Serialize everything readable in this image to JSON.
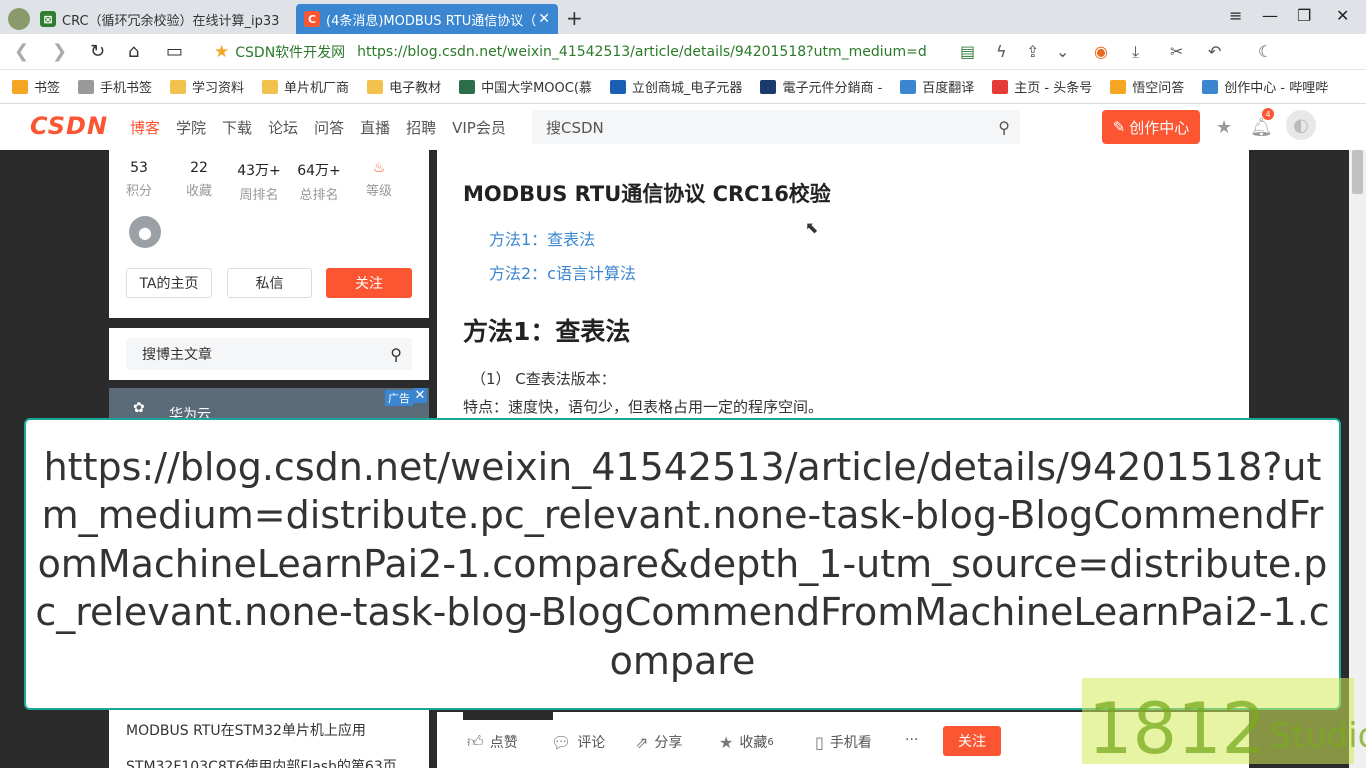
{
  "browser": {
    "tabs": [
      {
        "label": "CRC（循环冗余校验）在线计算_ip33",
        "icon": "sheet-icon"
      },
      {
        "label": "(4条消息)MODBUS RTU通信协议（",
        "icon": "csdn-c-icon"
      }
    ],
    "address": {
      "site_name": "CSDN软件开发网",
      "url": "https://blog.csdn.net/weixin_41542513/article/details/94201518?utm_medium=d"
    },
    "bookmarks": [
      {
        "label": "书签",
        "color": "#f5a623"
      },
      {
        "label": "手机书签",
        "color": "#999999"
      },
      {
        "label": "学习资料",
        "color": "#f2c14e"
      },
      {
        "label": "单片机厂商",
        "color": "#f2c14e"
      },
      {
        "label": "电子教材",
        "color": "#f2c14e"
      },
      {
        "label": "中国大学MOOC(慕",
        "color": "#2c6e49"
      },
      {
        "label": "立创商城_电子元器",
        "color": "#1a5fb4"
      },
      {
        "label": "電子元件分銷商 -",
        "color": "#1a3a6e"
      },
      {
        "label": "百度翻译",
        "color": "#3a86d1"
      },
      {
        "label": "主页 - 头条号",
        "color": "#e53935"
      },
      {
        "label": "悟空问答",
        "color": "#f5a623"
      },
      {
        "label": "创作中心 - 哔哩哔",
        "color": "#3a86d1"
      }
    ]
  },
  "csdn": {
    "logo": "CSDN",
    "nav": [
      "博客",
      "学院",
      "下载",
      "论坛",
      "问答",
      "直播",
      "招聘",
      "VIP会员"
    ],
    "search_placeholder": "搜CSDN",
    "create_label": "创作中心",
    "notify_count": "4"
  },
  "profile": {
    "stats": [
      {
        "value": "53",
        "label": "积分"
      },
      {
        "value": "22",
        "label": "收藏"
      },
      {
        "value": "43万+",
        "label": "周排名"
      },
      {
        "value": "64万+",
        "label": "总排名"
      },
      {
        "value": "",
        "label": "等级"
      }
    ],
    "home_label": "TA的主页",
    "message_label": "私信",
    "follow_label": "关注",
    "search_placeholder": "搜博主文章",
    "ad_tag": "广告",
    "ad_text": "华为云"
  },
  "article": {
    "title": "MODBUS RTU通信协议 CRC16校验",
    "toc": [
      "方法1：查表法",
      "方法2：c语言计算法"
    ],
    "heading": "方法1：查表法",
    "para1": "（1） C查表法版本：",
    "para2": "特点：速度快，语句少，但表格占用一定的程序空间。"
  },
  "overlay_url": "https://blog.csdn.net/weixin_41542513/article/details/94201518?utm_medium=distribute.pc_relevant.none-task-blog-BlogCommendFromMachineLearnPai2-1.compare&depth_1-utm_source=distribute.pc_relevant.none-task-blog-BlogCommendFromMachineLearnPai2-1.compare",
  "related": [
    "MODBUS RTU在STM32单片机上应用",
    "STM32F103C8T6使用内部Flash的第63页"
  ],
  "toolbar": {
    "like": "点赞",
    "comment": "评论",
    "share": "分享",
    "collect": "收藏",
    "collect_count": "6",
    "mobile": "手机看",
    "more": "···",
    "follow": "关注"
  },
  "watermark": {
    "digits": "1812",
    "word": "Studio"
  }
}
